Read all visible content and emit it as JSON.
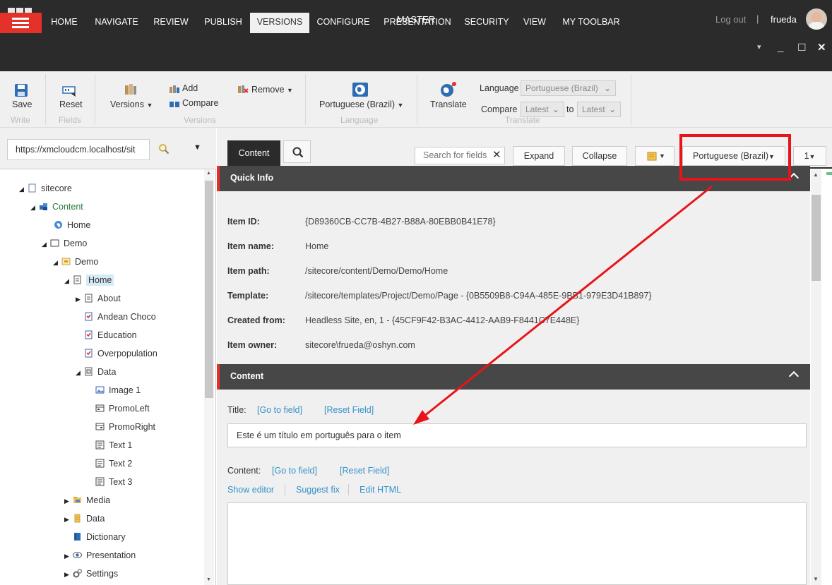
{
  "header": {
    "database": "MASTER",
    "logout": "Log out",
    "separator": "|",
    "username": "frueda"
  },
  "tabs": [
    "HOME",
    "NAVIGATE",
    "REVIEW",
    "PUBLISH",
    "VERSIONS",
    "CONFIGURE",
    "PRESENTATION",
    "SECURITY",
    "VIEW",
    "MY TOOLBAR"
  ],
  "active_tab": "VERSIONS",
  "window_controls": {
    "minimize_small": "▾",
    "minimize": "_",
    "maximize": "☐",
    "close": "✕"
  },
  "ribbon": {
    "save": "Save",
    "write_group": "Write",
    "reset": "Reset",
    "fields_group": "Fields",
    "versions": "Versions",
    "add": "Add",
    "compare": "Compare",
    "remove": "Remove",
    "versions_group": "Versions",
    "language_button": "Portuguese (Brazil)",
    "language_group": "Language",
    "translate": "Translate",
    "language_label": "Language",
    "language_value": "Portuguese (Brazil)",
    "compare_label": "Compare",
    "compare_from": "Latest",
    "to_label": "to",
    "compare_to": "Latest",
    "translate_group": "Translate"
  },
  "tree": {
    "path_value": "https://xmcloudcm.localhost/sit",
    "nodes": [
      {
        "label": "sitecore"
      },
      {
        "label": "Content"
      },
      {
        "label": "Home"
      },
      {
        "label": "Demo"
      },
      {
        "label": "Demo"
      },
      {
        "label": "Home"
      },
      {
        "label": "About"
      },
      {
        "label": "Andean Choco"
      },
      {
        "label": "Education"
      },
      {
        "label": "Overpopulation"
      },
      {
        "label": "Data"
      },
      {
        "label": "Image 1"
      },
      {
        "label": "PromoLeft"
      },
      {
        "label": "PromoRight"
      },
      {
        "label": "Text 1"
      },
      {
        "label": "Text 2"
      },
      {
        "label": "Text 3"
      },
      {
        "label": "Media"
      },
      {
        "label": "Data"
      },
      {
        "label": "Dictionary"
      },
      {
        "label": "Presentation"
      },
      {
        "label": "Settings"
      }
    ]
  },
  "editor": {
    "content_tab": "Content",
    "search_placeholder": "Search for fields",
    "expand": "Expand",
    "collapse": "Collapse",
    "language": "Portuguese (Brazil)",
    "version": "1",
    "quick_info_title": "Quick Info",
    "info": [
      {
        "label": "Item ID:",
        "value": "{D89360CB-CC7B-4B27-B88A-80EBB0B41E78}"
      },
      {
        "label": "Item name:",
        "value": "Home"
      },
      {
        "label": "Item path:",
        "value": "/sitecore/content/Demo/Demo/Home"
      },
      {
        "label": "Template:",
        "value": "/sitecore/templates/Project/Demo/Page - {0B5509B8-C94A-485E-9BB1-979E3D41B897}"
      },
      {
        "label": "Created from:",
        "value": "Headless Site, en, 1 - {45CF9F42-B3AC-4412-AAB9-F8441C7E448E}"
      },
      {
        "label": "Item owner:",
        "value": "sitecore\\frueda@oshyn.com"
      }
    ],
    "content_section_title": "Content",
    "title_label": "Title:",
    "go_to_field": "[Go to field]",
    "reset_field": "[Reset Field]",
    "title_value": "Este é um título em português para o item",
    "content_label": "Content:",
    "show_editor": "Show editor",
    "suggest_fix": "Suggest fix",
    "edit_html": "Edit HTML"
  },
  "colors": {
    "topbar": "#2b2b2b",
    "accent_red": "#e4322b",
    "link": "#3592c9",
    "annotation": "#e8141a"
  }
}
